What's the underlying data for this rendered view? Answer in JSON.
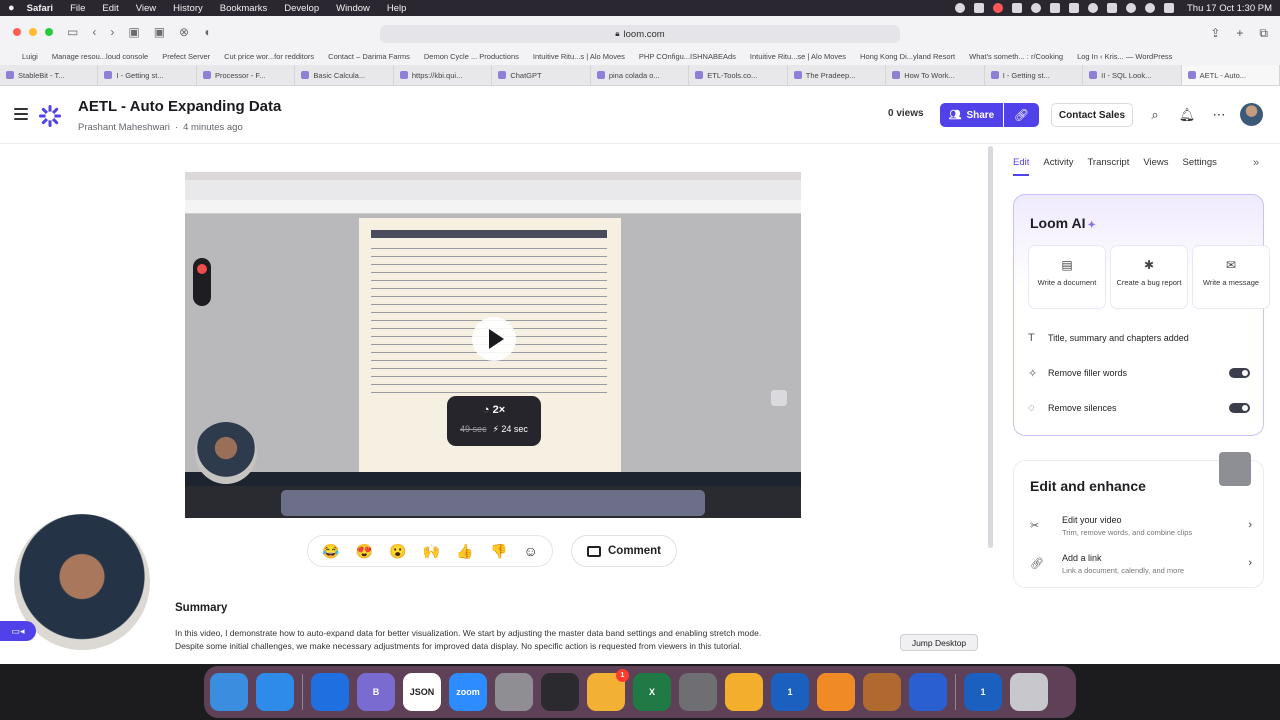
{
  "menubar": {
    "app": "Safari",
    "items": [
      "File",
      "Edit",
      "View",
      "History",
      "Bookmarks",
      "Develop",
      "Window",
      "Help"
    ],
    "clock": "Thu 17 Oct  1:30 PM"
  },
  "browser": {
    "url": "loom.com",
    "favorites": [
      "Luigi",
      "Manage resou...loud console",
      "Prefect Server",
      "Cut price wor...for redditors",
      "Contact – Darima Farms",
      "Demon Cycle ... Productions",
      "Intuitive Ritu...s | Alo Moves",
      "PHP COnfigu...ISHNABEAds",
      "Intuitive Ritu...se | Alo Moves",
      "Hong Kong Di...yland Resort",
      "What's someth... : r/Cooking",
      "Log In ‹ Kris... — WordPress"
    ],
    "tabs": [
      "StableBit - T...",
      "I - Getting st...",
      "Processor - F...",
      "Basic Calcula...",
      "https://kbi.qui...",
      "ChatGPT",
      "pina colada o...",
      "ETL-Tools.co...",
      "The Pradeep...",
      "How To Work...",
      "I - Getting st...",
      "II - SQL Look...",
      "AETL - Auto..."
    ]
  },
  "header": {
    "title": "AETL - Auto Expanding Data",
    "author": "Prashant Maheshwari",
    "time": "4 minutes ago",
    "views": "0 views",
    "share": "Share",
    "contact": "Contact Sales"
  },
  "video": {
    "speed": "2×",
    "old_time": "49 sec",
    "new_time": "24 sec"
  },
  "reactions": [
    "😂",
    "😍",
    "😮",
    "🙌",
    "👍",
    "👎"
  ],
  "comment_label": "Comment",
  "summary": {
    "heading": "Summary",
    "text": "In this video, I demonstrate how to auto-expand data for better visualization. We start by adjusting the master data band settings and enabling stretch mode. Despite some initial challenges, we make necessary adjustments for improved data display. No specific action is requested from viewers in this tutorial."
  },
  "panel": {
    "tabs": [
      "Edit",
      "Activity",
      "Transcript",
      "Views",
      "Settings"
    ],
    "ai_title": "Loom AI",
    "actions": [
      {
        "icon": "document-icon",
        "label": "Write a document"
      },
      {
        "icon": "bug-icon",
        "label": "Create a bug report"
      },
      {
        "icon": "message-icon",
        "label": "Write a message"
      }
    ],
    "rows": [
      {
        "label": "Title, summary and chapters added"
      },
      {
        "label": "Remove filler words",
        "toggle": true
      },
      {
        "label": "Remove silences",
        "toggle": true
      }
    ],
    "ee_title": "Edit and enhance",
    "ee_rows": [
      {
        "title": "Edit your video",
        "sub": "Trim, remove words, and combine clips"
      },
      {
        "title": "Add a link",
        "sub": "Link a document, calendly, and more"
      }
    ]
  },
  "tooltip": "Jump Desktop",
  "dock": {
    "apps": [
      {
        "name": "Finder",
        "label": "",
        "color": "#3b8de0"
      },
      {
        "name": "Safari",
        "label": "",
        "color": "#2e8bea"
      },
      {
        "name": "Whisper",
        "label": "",
        "color": "#1f6fe0"
      },
      {
        "name": "BBEdit",
        "label": "B",
        "color": "#7a6bd1"
      },
      {
        "name": "JSON",
        "label": "JSON",
        "color": "#ffffff"
      },
      {
        "name": "Zoom",
        "label": "zoom",
        "color": "#2d8cff"
      },
      {
        "name": "Tools",
        "label": "",
        "color": "#8e8e93"
      },
      {
        "name": "Prompt",
        "label": "",
        "color": "#2b2b2f"
      },
      {
        "name": "Photos",
        "label": "",
        "color": "#f2b134"
      },
      {
        "name": "Excel",
        "label": "X",
        "color": "#1f7a45"
      },
      {
        "name": "System Settings",
        "label": "",
        "color": "#6e6e73"
      },
      {
        "name": "Tableau",
        "label": "",
        "color": "#f3ae2b"
      },
      {
        "name": "1Password",
        "label": "1",
        "color": "#1b5fbf"
      },
      {
        "name": "Books",
        "label": "",
        "color": "#f08a24"
      },
      {
        "name": "Archive",
        "label": "",
        "color": "#b06a30"
      },
      {
        "name": "Jump Desktop",
        "label": "",
        "color": "#2a5fd1"
      },
      {
        "name": "1Password 2",
        "label": "1",
        "color": "#1b5fbf"
      },
      {
        "name": "Trash",
        "label": "",
        "color": "#c8c8cc"
      }
    ],
    "badge": "1"
  }
}
